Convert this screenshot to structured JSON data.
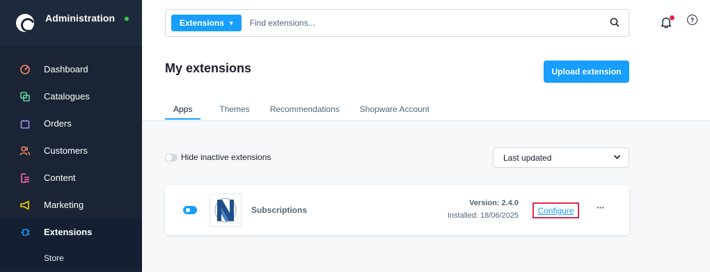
{
  "sidebar": {
    "title": "Administration",
    "status_color": "#37d046",
    "items": [
      {
        "label": "Dashboard",
        "icon": "dashboard-icon",
        "color": "#f88962"
      },
      {
        "label": "Catalogues",
        "icon": "catalogue-icon",
        "color": "#57d9a3"
      },
      {
        "label": "Orders",
        "icon": "orders-icon",
        "color": "#a092f0"
      },
      {
        "label": "Customers",
        "icon": "customers-icon",
        "color": "#f88962"
      },
      {
        "label": "Content",
        "icon": "content-icon",
        "color": "#ff68b4"
      },
      {
        "label": "Marketing",
        "icon": "marketing-icon",
        "color": "#ffd700"
      },
      {
        "label": "Extensions",
        "icon": "extensions-icon",
        "color": "#189eff"
      }
    ],
    "sub_items": [
      {
        "label": "Store"
      }
    ]
  },
  "search": {
    "type_label": "Extensions",
    "placeholder": "Find extensions..."
  },
  "page": {
    "title": "My extensions",
    "upload_label": "Upload extension",
    "tabs": [
      {
        "label": "Apps"
      },
      {
        "label": "Themes"
      },
      {
        "label": "Recommendations"
      },
      {
        "label": "Shopware Account"
      }
    ],
    "hide_inactive_label": "Hide inactive extensions",
    "sort_value": "Last updated"
  },
  "extension": {
    "name": "Subscriptions",
    "version": "Version: 2.4.0",
    "installed": "Installed: 18/06/2025",
    "configure_label": "Configure",
    "more_label": "···",
    "active": true
  },
  "colors": {
    "accent": "#189eff",
    "sidebar_bg": "#1a2434",
    "highlight_border": "#de294c"
  }
}
